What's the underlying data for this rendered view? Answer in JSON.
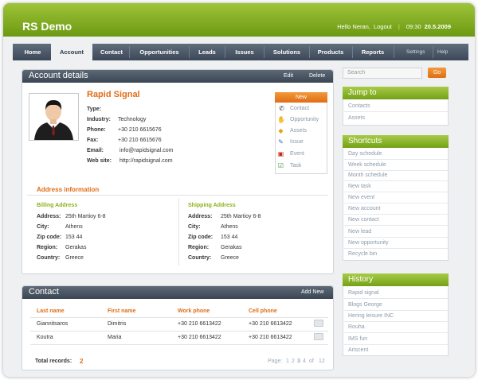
{
  "app": {
    "title": "RS Demo"
  },
  "header": {
    "greeting": "Hello Neran,",
    "logout": "Logout",
    "time": "09:30",
    "date": "20.5.2009"
  },
  "nav": {
    "tabs": [
      "Home",
      "Account",
      "Contact",
      "Opportunities",
      "Leads",
      "Issues",
      "Solutions",
      "Products",
      "Reports"
    ],
    "active": "Account",
    "settings": "Settings",
    "help": "Help"
  },
  "account": {
    "panel_title": "Account details",
    "edit": "Edit",
    "delete": "Delete",
    "company": "Rapid Signal",
    "fields": [
      {
        "label": "Type:",
        "value": ""
      },
      {
        "label": "Industry:",
        "value": "Technology"
      },
      {
        "label": "Phone:",
        "value": "+30 210 6615676"
      },
      {
        "label": "Fax:",
        "value": "+30 210 6615676"
      },
      {
        "label": "Email:",
        "value": "info@rapidsignal.com"
      },
      {
        "label": "Web site:",
        "value": "http://rapidsignal.com"
      }
    ],
    "new_button": "New",
    "new_items": [
      "Contact",
      "Opportunity",
      "Assets",
      "Issue",
      "Event",
      "Task"
    ]
  },
  "address": {
    "section_title": "Address information",
    "billing_title": "Billing Address",
    "shipping_title": "Shipping Address",
    "labels": [
      "Address:",
      "City:",
      "Zip code:",
      "Region:",
      "Country:"
    ],
    "billing": [
      "25th Martioy 6-8",
      "Athens",
      "153 44",
      "Gerakas",
      "Greece"
    ],
    "shipping": [
      "25th Martioy 6-8",
      "Athens",
      "153 44",
      "Gerakas",
      "Greece"
    ]
  },
  "contact": {
    "panel_title": "Contact",
    "add_new": "Add New",
    "columns": [
      "Last name",
      "First name",
      "Work phone",
      "Cell phone"
    ],
    "rows": [
      [
        "Giannitsaros",
        "Dimitris",
        "+30 210 6613422",
        "+30 210 6613422"
      ],
      [
        "Koutra",
        "Maria",
        "+30 210 6613422",
        "+30 210 6613422"
      ]
    ],
    "total_label": "Total records:",
    "total_value": "2",
    "page_label": "Page:",
    "pages": [
      "1",
      "2",
      "3",
      "4"
    ],
    "current_page": "3",
    "of_label": "of",
    "page_total": "12"
  },
  "sidebar": {
    "search_placeholder": "Search",
    "go": "Go",
    "jump_title": "Jump to",
    "jump_items": [
      "Contacts",
      "Assets"
    ],
    "shortcuts_title": "Shortcuts",
    "shortcuts": [
      "Day schedule",
      "Week schedule",
      "Month schedule",
      "New task",
      "New event",
      "New account",
      "New contact",
      "New lead",
      "New opportunity",
      "Recycle bin"
    ],
    "history_title": "History",
    "history": [
      "Rapid signal",
      "Blogs George",
      "Hering leisure INC",
      "Rouha",
      "IMS fun",
      "Ariscent"
    ]
  },
  "colors": {
    "brand_green": "#7aa31a",
    "accent_orange": "#e06d15",
    "nav_slate": "#4a5665"
  }
}
